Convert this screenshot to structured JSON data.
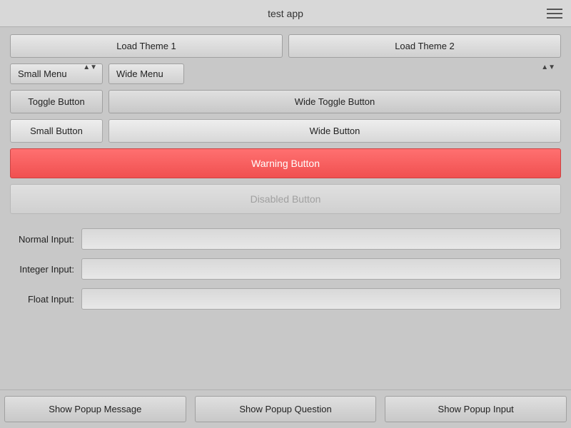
{
  "titleBar": {
    "title": "test app"
  },
  "buttons": {
    "loadTheme1": "Load Theme 1",
    "loadTheme2": "Load Theme 2",
    "smallMenu": "Small Menu",
    "wideMenu": "Wide Menu",
    "toggleButton": "Toggle Button",
    "wideToggleButton": "Wide Toggle Button",
    "smallButton": "Small Button",
    "wideButton": "Wide Button",
    "warningButton": "Warning Button",
    "disabledButton": "Disabled Button"
  },
  "inputs": {
    "normalLabel": "Normal Input:",
    "integerLabel": "Integer Input:",
    "floatLabel": "Float Input:",
    "normalValue": "",
    "integerValue": "",
    "floatValue": ""
  },
  "popups": {
    "showMessage": "Show Popup Message",
    "showQuestion": "Show Popup Question",
    "showInput": "Show Popup Input"
  }
}
